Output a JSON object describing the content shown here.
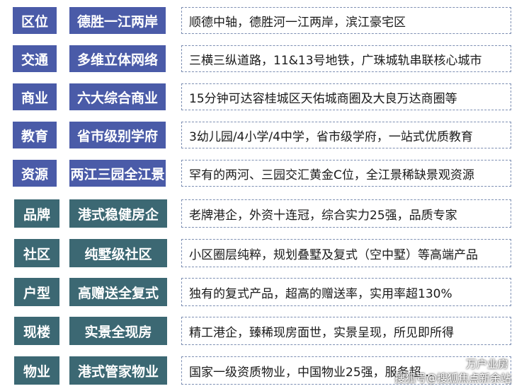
{
  "rows": [
    {
      "category": "区位",
      "title": "德胜一江两岸",
      "description": "顺德中轴，德胜河一江两岸，滨江豪宅区"
    },
    {
      "category": "交通",
      "title": "多维立体网络",
      "description": "三横三纵道路，11&13号地铁，广珠城轨串联核心城市"
    },
    {
      "category": "商业",
      "title": "六大综合商业",
      "description": "15分钟可达容桂城区天佑城商圈及大良万达商圈等"
    },
    {
      "category": "教育",
      "title": "省市级别学府",
      "description": "3幼儿园/4小学/4中学，省市级学府，一站式优质教育"
    },
    {
      "category": "资源",
      "title": "两江三园全江景",
      "description": "罕有的两河、三园交汇黄金C位，全江景稀缺景观资源"
    },
    {
      "category": "品牌",
      "title": "港式稳健房企",
      "description": "老牌港企，外资十连冠，综合实力25强，品质专家"
    },
    {
      "category": "社区",
      "title": "纯墅级社区",
      "description": "小区圈层纯粹，规划叠墅及复式（空中墅）等高端产品"
    },
    {
      "category": "户型",
      "title": "高赠送全复式",
      "description": "独有的复式产品，超高的赠送率，实用率超130%"
    },
    {
      "category": "现楼",
      "title": "实景全现房",
      "description": "精工港企，臻稀现房面世，实景呈现，所见即所得"
    },
    {
      "category": "物业",
      "title": "港式管家物业",
      "description": "国家一级资质物业，中国物业25强，服务超…"
    }
  ],
  "watermark": {
    "line1": "万户业房",
    "line2": "搜狐号@搜狐焦点新余站"
  },
  "colors": {
    "blue": "#4a5ba8",
    "teal": "#3c6873",
    "border": "#7d8fb3"
  }
}
